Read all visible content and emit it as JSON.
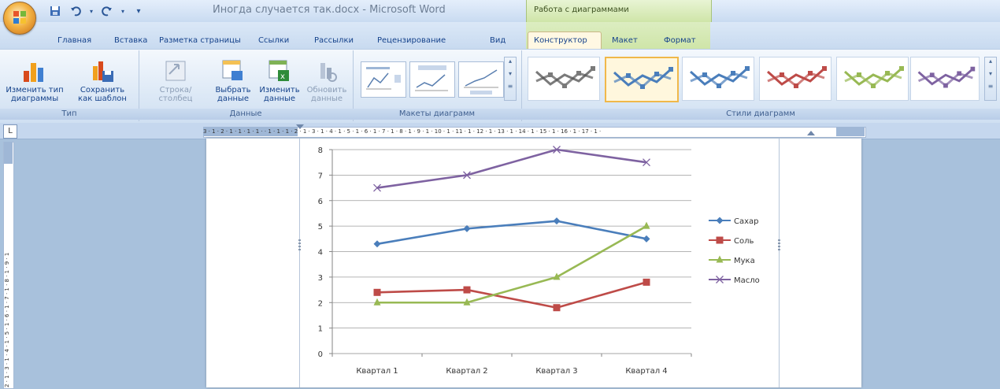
{
  "title_bar": {
    "document_title": "Иногда случается так.docx - Microsoft Word",
    "context_title": "Работа с диаграммами",
    "quick_access": [
      "save-icon",
      "undo-icon",
      "redo-icon",
      "customize-icon"
    ]
  },
  "tabs": [
    "Главная",
    "Вставка",
    "Разметка страницы",
    "Ссылки",
    "Рассылки",
    "Рецензирование",
    "Вид",
    "Конструктор",
    "Макет",
    "Формат"
  ],
  "active_tab": "Конструктор",
  "ribbon": {
    "type_group": {
      "label": "Тип",
      "buttons": [
        {
          "line1": "Изменить тип",
          "line2": "диаграммы"
        },
        {
          "line1": "Сохранить",
          "line2": "как шаблон"
        }
      ]
    },
    "data_group": {
      "label": "Данные",
      "buttons": [
        {
          "line1": "Строка/столбец",
          "line2": ""
        },
        {
          "line1": "Выбрать",
          "line2": "данные"
        },
        {
          "line1": "Изменить",
          "line2": "данные"
        },
        {
          "line1": "Обновить",
          "line2": "данные"
        }
      ]
    },
    "layouts_group": {
      "label": "Макеты диаграмм"
    },
    "styles_group": {
      "label": "Стили диаграмм"
    },
    "style_colors": [
      "#7a7a7a",
      "#4a7ebb",
      "#4a7ebb",
      "#be4b48",
      "#98b954",
      "#7e62a1"
    ]
  },
  "ruler": {
    "text": "3 · 1 · 2 · 1 · 1 · 1 · 1 · · 1 · 1 · 1 · 2 · 1 · 3 · 1 · 4 · 1 · 5 · 1 · 6 · 1 · 7 · 1 · 8 · 1 · 9 · 1 · 10 · 1 · 11 · 1 · 12 · 1 · 13 · 1 · 14 · 1 · 15 · 1 · 16 · 1 · 17 · 1 ·",
    "vertical_text": "2 · 1 · 3 · 1 · 4 · 1 · 5 · 1 · 6 · 1 · 7 · 1 · 8 · 1 · 9 · 1",
    "tab_stop": "L"
  },
  "chart_data": {
    "type": "line",
    "categories": [
      "Квартал 1",
      "Квартал 2",
      "Квартал 3",
      "Квартал 4"
    ],
    "ylim": [
      0,
      8
    ],
    "yticks": [
      0,
      1,
      2,
      3,
      4,
      5,
      6,
      7,
      8
    ],
    "grid": true,
    "legend_position": "right",
    "series": [
      {
        "name": "Сахар",
        "color": "#4a7ebb",
        "marker": "diamond",
        "values": [
          4.3,
          4.9,
          5.2,
          4.5
        ]
      },
      {
        "name": "Соль",
        "color": "#be4b48",
        "marker": "square",
        "values": [
          2.4,
          2.5,
          1.8,
          2.8
        ]
      },
      {
        "name": "Мука",
        "color": "#98b954",
        "marker": "triangle",
        "values": [
          2.0,
          2.0,
          3.0,
          5.0
        ]
      },
      {
        "name": "Масло",
        "color": "#7e62a1",
        "marker": "x",
        "values": [
          6.5,
          7.0,
          8.0,
          7.5
        ]
      }
    ]
  }
}
